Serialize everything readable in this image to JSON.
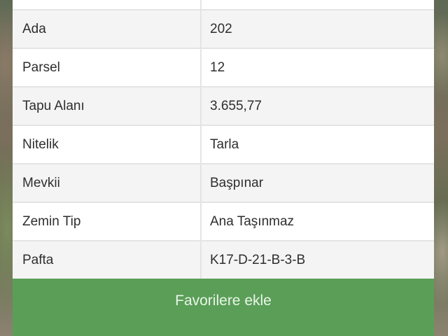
{
  "details": {
    "rows": [
      {
        "label": "Ada",
        "value": "202"
      },
      {
        "label": "Parsel",
        "value": "12"
      },
      {
        "label": "Tapu Alanı",
        "value": "3.655,77"
      },
      {
        "label": "Nitelik",
        "value": "Tarla"
      },
      {
        "label": "Mevkii",
        "value": "Başpınar"
      },
      {
        "label": "Zemin Tip",
        "value": "Ana Taşınmaz"
      },
      {
        "label": "Pafta",
        "value": "K17-D-21-B-3-B"
      }
    ]
  },
  "actions": {
    "favorite_label": "Favorilere ekle"
  },
  "colors": {
    "button_green": "#5a9e58",
    "row_alt": "#f4f4f4",
    "divider": "#e4e4e4"
  }
}
